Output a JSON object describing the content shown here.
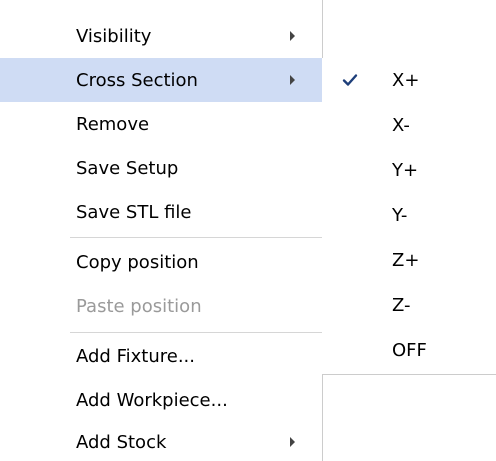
{
  "main_menu": {
    "items": [
      {
        "label": "Visibility",
        "has_submenu": true,
        "highlighted": false,
        "disabled": false
      },
      {
        "label": "Cross Section",
        "has_submenu": true,
        "highlighted": true,
        "disabled": false
      },
      {
        "label": "Remove",
        "has_submenu": false,
        "highlighted": false,
        "disabled": false
      },
      {
        "label": "Save Setup",
        "has_submenu": false,
        "highlighted": false,
        "disabled": false
      },
      {
        "label": "Save STL file",
        "has_submenu": false,
        "highlighted": false,
        "disabled": false
      },
      {
        "label": "Copy position",
        "has_submenu": false,
        "highlighted": false,
        "disabled": false
      },
      {
        "label": "Paste position",
        "has_submenu": false,
        "highlighted": false,
        "disabled": true
      },
      {
        "label": "Add Fixture...",
        "has_submenu": false,
        "highlighted": false,
        "disabled": false
      },
      {
        "label": "Add Workpiece...",
        "has_submenu": false,
        "highlighted": false,
        "disabled": false
      },
      {
        "label": "Add Stock",
        "has_submenu": true,
        "highlighted": false,
        "disabled": false
      }
    ]
  },
  "cross_section_submenu": {
    "items": [
      {
        "label": "X+",
        "checked": true
      },
      {
        "label": "X-",
        "checked": false
      },
      {
        "label": "Y+",
        "checked": false
      },
      {
        "label": "Y-",
        "checked": false
      },
      {
        "label": "Z+",
        "checked": false
      },
      {
        "label": "Z-",
        "checked": false
      },
      {
        "label": "OFF",
        "checked": false
      }
    ]
  },
  "colors": {
    "highlight": "#cfdcf4",
    "disabled_text": "#9a9a9a",
    "separator": "#d6d6d6"
  }
}
